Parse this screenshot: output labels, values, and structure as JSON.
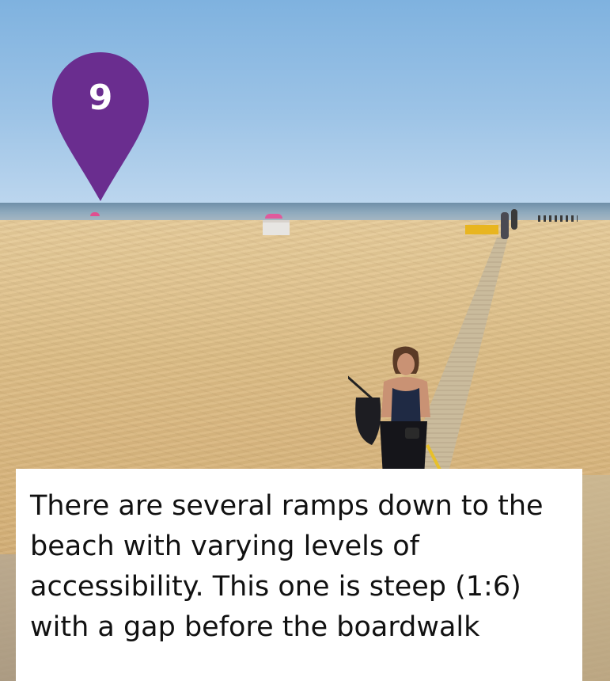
{
  "marker": {
    "number": "9",
    "color": "#6a2d8f"
  },
  "caption": {
    "text": "There are several ramps down to the beach with varying levels of accessibility. This one is steep (1:6) with a gap before the boardwalk"
  }
}
